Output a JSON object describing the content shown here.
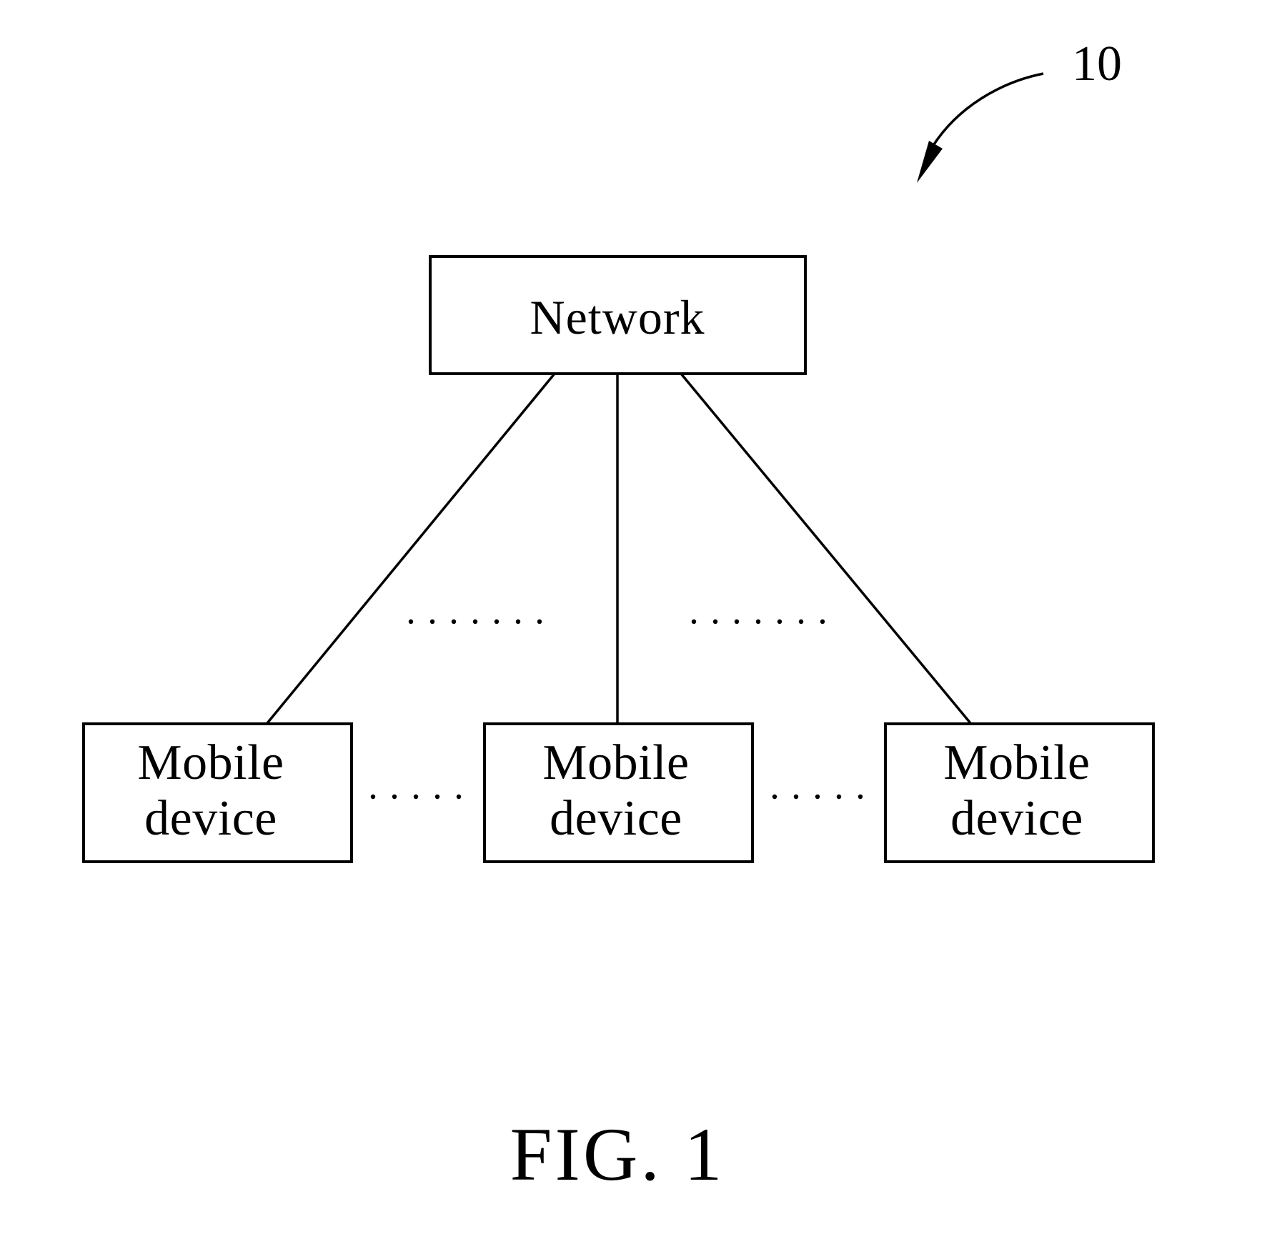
{
  "figure": {
    "reference_numeral": "10",
    "caption": "FIG. 1",
    "network": {
      "label": "Network"
    },
    "mobile_devices": [
      {
        "line1": "Mobile",
        "line2": "device"
      },
      {
        "line1": "Mobile",
        "line2": "device"
      },
      {
        "line1": "Mobile",
        "line2": "device"
      }
    ],
    "ellipses": {
      "upper_left_dots": 7,
      "upper_right_dots": 7,
      "lower_left_dots": 5,
      "lower_right_dots": 5
    },
    "colors": {
      "stroke": "#000000",
      "background": "#ffffff"
    }
  }
}
